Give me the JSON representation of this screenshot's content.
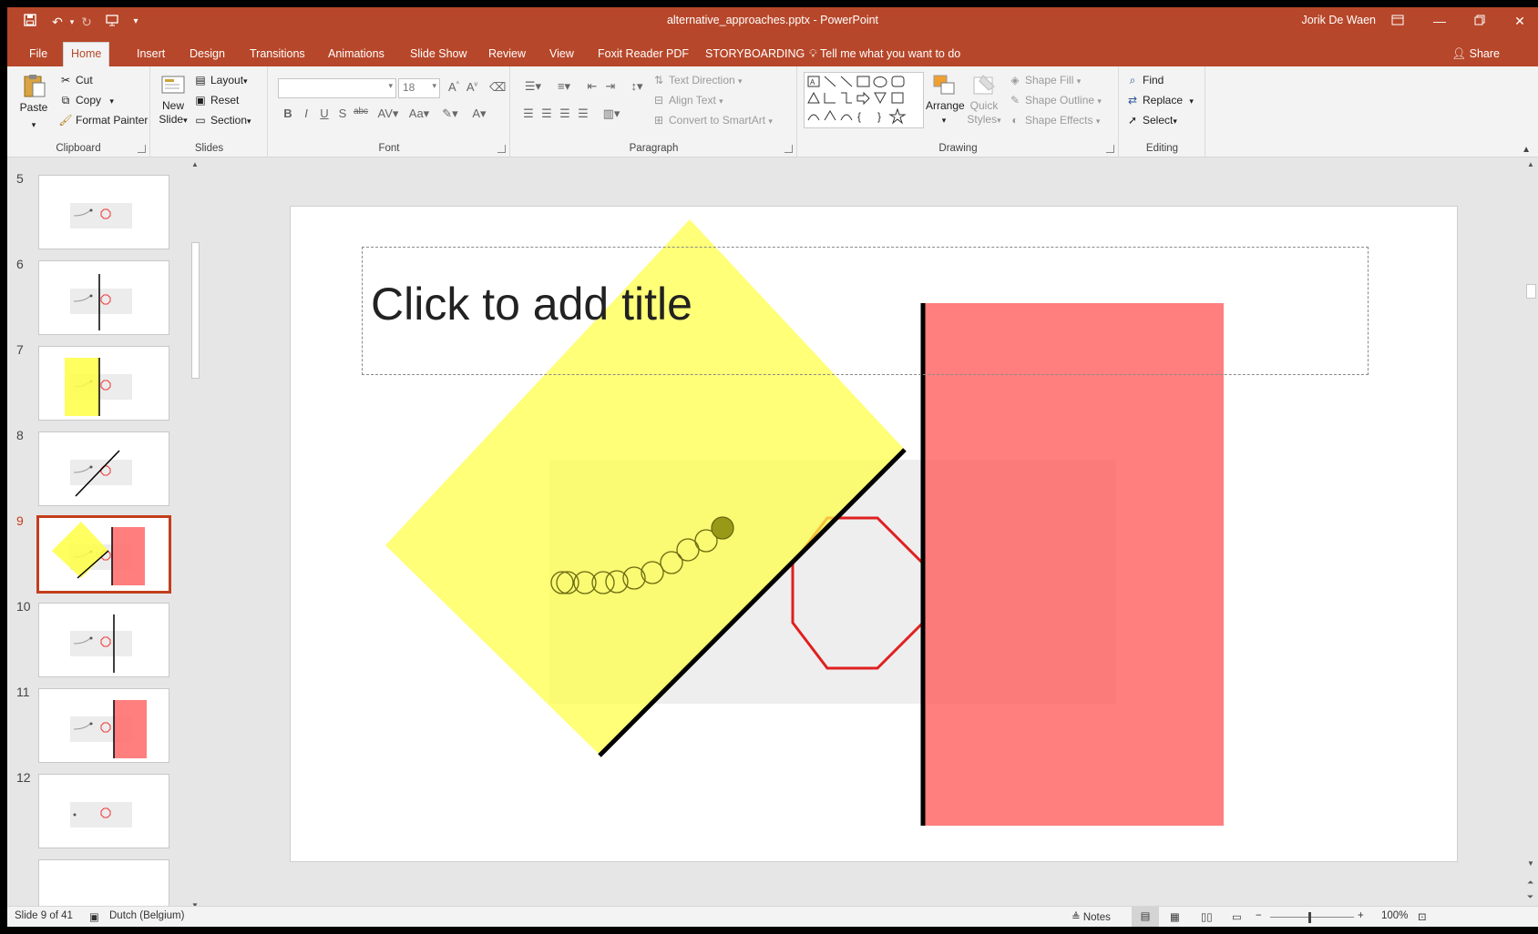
{
  "window": {
    "doc_title": "alternative_approaches.pptx - PowerPoint",
    "user_name": "Jorik De Waen"
  },
  "tabs": [
    "File",
    "Home",
    "Insert",
    "Design",
    "Transitions",
    "Animations",
    "Slide Show",
    "Review",
    "View",
    "Foxit Reader PDF",
    "STORYBOARDING"
  ],
  "active_tab": "Home",
  "tell_me": "Tell me what you want to do",
  "share": "Share",
  "ribbon": {
    "clipboard": {
      "label": "Clipboard",
      "paste": "Paste",
      "cut": "Cut",
      "copy": "Copy",
      "format_painter": "Format Painter"
    },
    "slides": {
      "label": "Slides",
      "new_slide_1": "New",
      "new_slide_2": "Slide",
      "layout": "Layout",
      "reset": "Reset",
      "section": "Section"
    },
    "font": {
      "label": "Font",
      "font_name": "",
      "font_size": "18"
    },
    "paragraph": {
      "label": "Paragraph",
      "text_direction": "Text Direction",
      "align_text": "Align Text",
      "convert_smartart": "Convert to SmartArt"
    },
    "drawing": {
      "label": "Drawing",
      "arrange": "Arrange",
      "quick_styles_1": "Quick",
      "quick_styles_2": "Styles",
      "shape_fill": "Shape Fill",
      "shape_outline": "Shape Outline",
      "shape_effects": "Shape Effects"
    },
    "editing": {
      "label": "Editing",
      "find": "Find",
      "replace": "Replace",
      "select": "Select"
    }
  },
  "slides_panel": {
    "items": [
      {
        "num": "5"
      },
      {
        "num": "6"
      },
      {
        "num": "7"
      },
      {
        "num": "8"
      },
      {
        "num": "9",
        "active": true
      },
      {
        "num": "10"
      },
      {
        "num": "11"
      },
      {
        "num": "12"
      }
    ]
  },
  "slide": {
    "title_placeholder": "Click to add title"
  },
  "colors": {
    "accent": "#b7472a",
    "active_thumb": "#c43e1c",
    "yellow_shape": "#ffff66",
    "red_shape": "#ff7b7b",
    "octagon": "#e02020",
    "grey_box": "#eeeeee"
  },
  "status": {
    "slide_counter": "Slide 9 of 41",
    "language": "Dutch (Belgium)",
    "notes": "Notes",
    "zoom": "100%"
  }
}
